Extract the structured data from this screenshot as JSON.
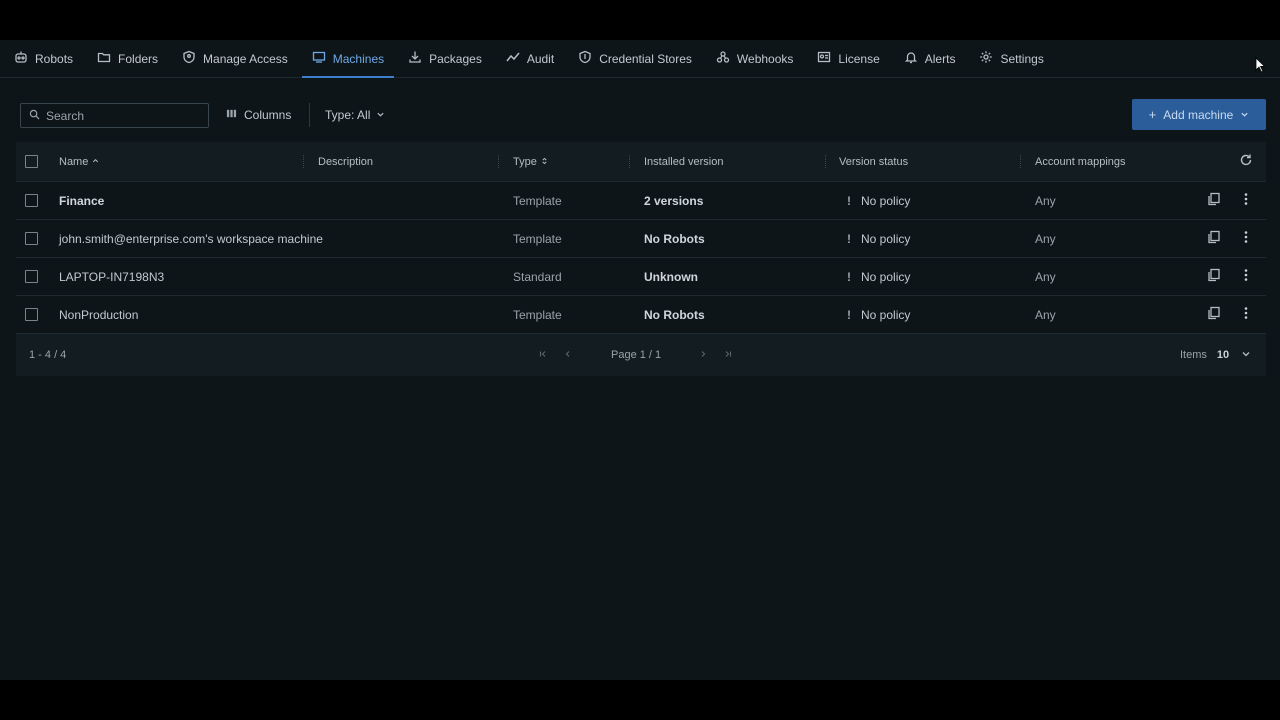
{
  "colors": {
    "accent": "#3c7ec9",
    "button": "#2a5d9a",
    "background": "#0e1519"
  },
  "nav": {
    "items": [
      {
        "label": "Robots",
        "icon": "robot-icon"
      },
      {
        "label": "Folders",
        "icon": "folder-icon"
      },
      {
        "label": "Manage Access",
        "icon": "shield-icon"
      },
      {
        "label": "Machines",
        "icon": "monitor-icon",
        "active": true
      },
      {
        "label": "Packages",
        "icon": "download-icon"
      },
      {
        "label": "Audit",
        "icon": "trend-icon"
      },
      {
        "label": "Credential Stores",
        "icon": "shield-key-icon"
      },
      {
        "label": "Webhooks",
        "icon": "webhook-icon"
      },
      {
        "label": "License",
        "icon": "license-icon"
      },
      {
        "label": "Alerts",
        "icon": "bell-icon"
      },
      {
        "label": "Settings",
        "icon": "gear-icon"
      }
    ]
  },
  "toolbar": {
    "search_placeholder": "Search",
    "columns_label": "Columns",
    "type_filter_label": "Type: All",
    "add_button_label": "Add machine"
  },
  "table": {
    "headers": {
      "name": "Name",
      "description": "Description",
      "type": "Type",
      "installed_version": "Installed version",
      "version_status": "Version status",
      "account_mappings": "Account mappings"
    },
    "rows": [
      {
        "name": "Finance",
        "description": "",
        "type": "Template",
        "installed_version": "2 versions",
        "version_status": "No policy",
        "account_mappings": "Any"
      },
      {
        "name": "john.smith@enterprise.com's workspace machine",
        "description": "",
        "type": "Template",
        "installed_version": "No Robots",
        "version_status": "No policy",
        "account_mappings": "Any"
      },
      {
        "name": "LAPTOP-IN7198N3",
        "description": "",
        "type": "Standard",
        "installed_version": "Unknown",
        "version_status": "No policy",
        "account_mappings": "Any"
      },
      {
        "name": "NonProduction",
        "description": "",
        "type": "Template",
        "installed_version": "No Robots",
        "version_status": "No policy",
        "account_mappings": "Any"
      }
    ]
  },
  "footer": {
    "range": "1 - 4 / 4",
    "page_label": "Page 1 / 1",
    "items_label": "Items",
    "items_value": "10"
  }
}
